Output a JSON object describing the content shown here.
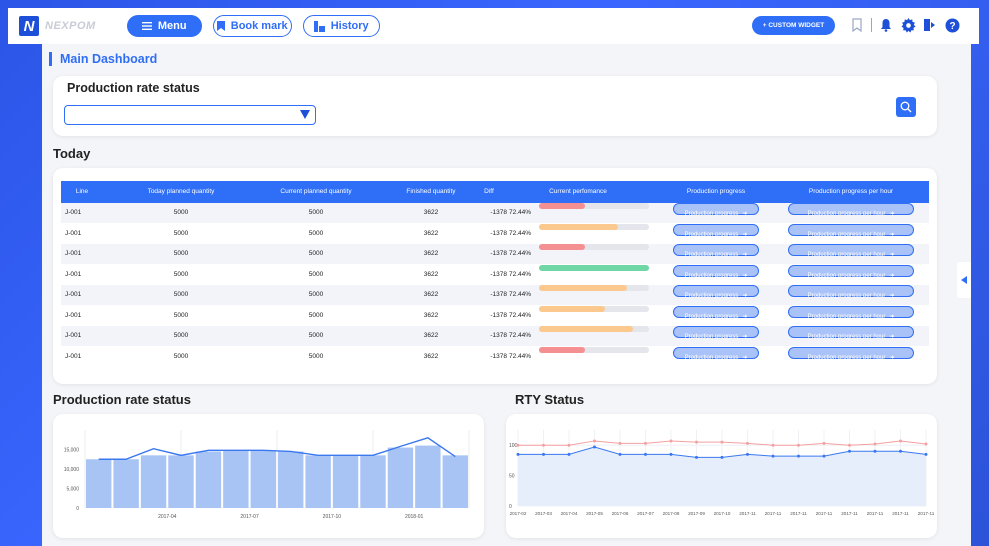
{
  "topbar": {
    "logo_mark": "N",
    "logo_text": "NEXPOM",
    "menu_label": "Menu",
    "bookmark_label": "Book mark",
    "history_label": "History",
    "custom_widget_label": "+ CUSTOM WIDGET",
    "icons": [
      "bookmark-icon",
      "bell-icon",
      "gear-icon",
      "logout-icon",
      "help-icon"
    ]
  },
  "page_title": "Main Dashboard",
  "filter_card": {
    "title": "Production rate status",
    "select_value": ""
  },
  "today": {
    "title": "Today",
    "columns": [
      "Line",
      "Today planned quantity",
      "Current planned quantity",
      "Finished quantity",
      "Diff",
      "Current perfomance",
      "Production progress",
      "Production progress per hour"
    ],
    "rows": [
      {
        "line": "J-001",
        "tpq": "5000",
        "cpq": "5000",
        "fq": "3622",
        "diff": "-1378",
        "perf": "72.44%",
        "perf_fill": 0.42,
        "color": "#f48f92",
        "pp": "Production progress",
        "pph": "Production progress per hour"
      },
      {
        "line": "J-001",
        "tpq": "5000",
        "cpq": "5000",
        "fq": "3622",
        "diff": "-1378",
        "perf": "72.44%",
        "perf_fill": 0.72,
        "color": "#fbc98d",
        "pp": "Production progress",
        "pph": "Production progress per hour"
      },
      {
        "line": "J-001",
        "tpq": "5000",
        "cpq": "5000",
        "fq": "3622",
        "diff": "-1378",
        "perf": "72.44%",
        "perf_fill": 0.42,
        "color": "#f48f92",
        "pp": "Production progress",
        "pph": "Production progress per hour"
      },
      {
        "line": "J-001",
        "tpq": "5000",
        "cpq": "5000",
        "fq": "3622",
        "diff": "-1378",
        "perf": "72.44%",
        "perf_fill": 1.0,
        "color": "#6fd6a5",
        "pp": "Production progress",
        "pph": "Production progress per hour"
      },
      {
        "line": "J-001",
        "tpq": "5000",
        "cpq": "5000",
        "fq": "3622",
        "diff": "-1378",
        "perf": "72.44%",
        "perf_fill": 0.8,
        "color": "#fbc98d",
        "pp": "Production progress",
        "pph": "Production progress per hour"
      },
      {
        "line": "J-001",
        "tpq": "5000",
        "cpq": "5000",
        "fq": "3622",
        "diff": "-1378",
        "perf": "72.44%",
        "perf_fill": 0.6,
        "color": "#fbc98d",
        "pp": "Production progress",
        "pph": "Production progress per hour"
      },
      {
        "line": "J-001",
        "tpq": "5000",
        "cpq": "5000",
        "fq": "3622",
        "diff": "-1378",
        "perf": "72.44%",
        "perf_fill": 0.85,
        "color": "#fbc98d",
        "pp": "Production progress",
        "pph": "Production progress per hour"
      },
      {
        "line": "J-001",
        "tpq": "5000",
        "cpq": "5000",
        "fq": "3622",
        "diff": "-1378",
        "perf": "72.44%",
        "perf_fill": 0.42,
        "color": "#f48f92",
        "pp": "Production progress",
        "pph": "Production progress per hour"
      }
    ]
  },
  "chart_titles": {
    "production": "Production rate status",
    "rty": "RTY Status"
  },
  "chart_data": [
    {
      "type": "bar",
      "title": "Production rate status",
      "x_tick_labels": [
        "2017-04",
        "2017-07",
        "2017-10",
        "2018-01"
      ],
      "y_tick_labels": [
        "0",
        "5,000",
        "10,000",
        "15,000"
      ],
      "ylim": [
        0,
        20000
      ],
      "bars": [
        12500,
        12500,
        13500,
        13500,
        14500,
        14800,
        14800,
        14500,
        13500,
        13500,
        13500,
        15500,
        16000,
        13500
      ],
      "line": [
        12500,
        12500,
        15200,
        13500,
        14800,
        14800,
        14800,
        14500,
        13500,
        13500,
        13500,
        15800,
        18000,
        13200
      ],
      "bar_color": "#a8c4f5",
      "line_color": "#3a78f0"
    },
    {
      "type": "line",
      "title": "RTY Status",
      "categories": [
        "2017-02",
        "2017-03",
        "2017-04",
        "2017-05",
        "2017-06",
        "2017-07",
        "2017-08",
        "2017-09",
        "2017-10",
        "2017-11",
        "2017-11",
        "2017-11",
        "2017-11",
        "2017-11",
        "2017-11",
        "2017-11",
        "2017-11"
      ],
      "y_tick_labels": [
        "0",
        "50",
        "100"
      ],
      "ylim": [
        0,
        125
      ],
      "series": [
        {
          "values": [
            100,
            100,
            100,
            107,
            103,
            103,
            107,
            105,
            105,
            103,
            100,
            100,
            103,
            100,
            102,
            107,
            102
          ],
          "color": "#f4a0a0"
        },
        {
          "values": [
            85,
            85,
            85,
            97,
            85,
            85,
            85,
            80,
            80,
            85,
            82,
            82,
            82,
            90,
            90,
            90,
            85
          ],
          "color": "#3a78f0"
        }
      ]
    }
  ]
}
